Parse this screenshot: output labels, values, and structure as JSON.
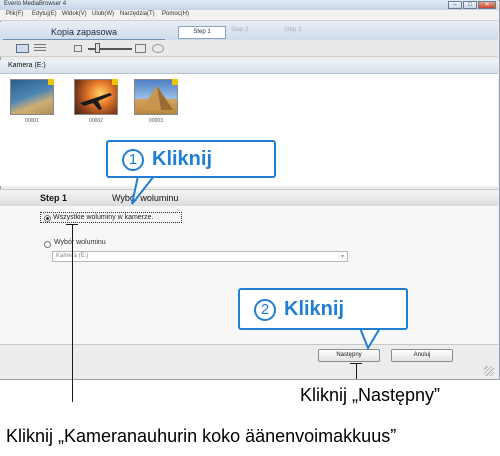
{
  "window": {
    "title": "Everio MediaBrowser 4",
    "controls": [
      "–",
      "□",
      "✕"
    ]
  },
  "menu": [
    "Plik(F)",
    "Edytuj(E)",
    "Widok(V)",
    "Ulub(W)",
    "Narzędzia(T)",
    "Pomoc(H)"
  ],
  "header": {
    "active_tab": "Kopia zapasowa",
    "steps": [
      "Step 1",
      "Step 2",
      "Step 3"
    ]
  },
  "toolbar": {
    "icons": [
      "grid-view-icon",
      "list-view-icon",
      "zoom-out-icon",
      "zoom-slider",
      "zoom-in-icon",
      "refresh-icon"
    ]
  },
  "section": {
    "camera_label": "Kamera (E:)"
  },
  "thumbnails": [
    {
      "label": "00001",
      "colors": [
        "#2c5f8a",
        "#cfae74"
      ]
    },
    {
      "label": "00002",
      "colors": [
        "#e67b2a",
        "#3a2418"
      ]
    },
    {
      "label": "00003",
      "colors": [
        "#4d7fc4",
        "#d3a35f"
      ]
    }
  ],
  "step_strip": {
    "step": "Step 1",
    "title": "Wybór woluminu"
  },
  "options": {
    "all_volumes": "Wszystkie woluminy w kamerze.",
    "select_volume": "Wybór woluminu",
    "dropdown_value": "Kamera (E:)"
  },
  "buttons": {
    "next": "Następny",
    "cancel": "Anuluj"
  },
  "callouts": [
    {
      "number": "1",
      "text": "Kliknij"
    },
    {
      "number": "2",
      "text": "Kliknij"
    }
  ],
  "annotations": {
    "next": "Kliknij „Następny”",
    "all_volumes": "Kliknij „Kameranauhurin koko äänenvoimakkuus”"
  },
  "colors": {
    "callout_blue": "#1f7fd4",
    "flag_yellow": "#f2c400"
  }
}
